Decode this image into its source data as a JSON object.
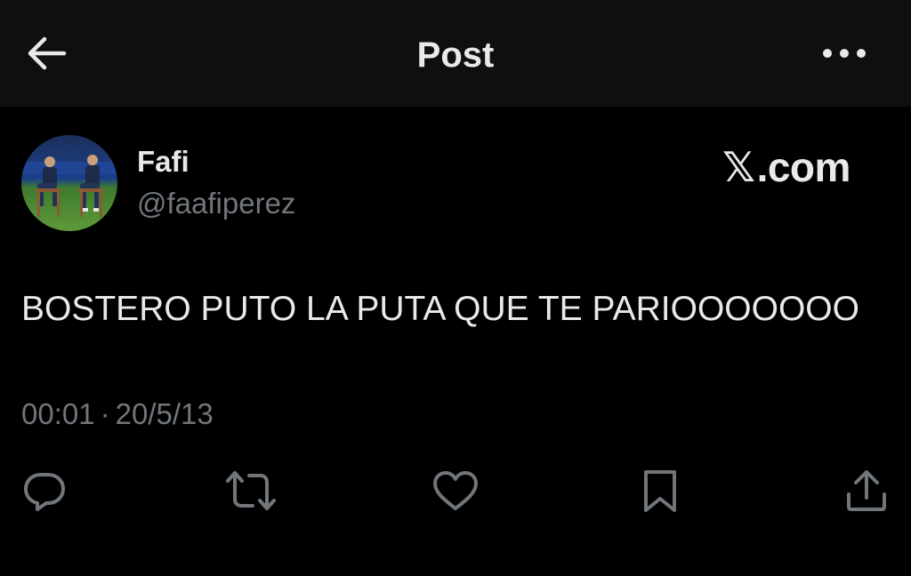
{
  "header": {
    "title": "Post",
    "back_icon": "arrow-left-icon",
    "more_icon": "more-horizontal-icon"
  },
  "post": {
    "author": {
      "display_name": "Fafi",
      "handle": "@faafiperez",
      "avatar": "avatar-photo"
    },
    "brand": {
      "symbol": "𝕏",
      "suffix": ".com"
    },
    "text": "BOSTERO PUTO LA PUTA QUE TE PARIOOOOOOO",
    "time": "00:01",
    "separator": "·",
    "date": "20/5/13"
  },
  "actions": [
    {
      "name": "reply",
      "icon": "reply-icon"
    },
    {
      "name": "repost",
      "icon": "repost-icon"
    },
    {
      "name": "like",
      "icon": "heart-icon"
    },
    {
      "name": "bookmark",
      "icon": "bookmark-icon"
    },
    {
      "name": "share",
      "icon": "share-icon"
    }
  ],
  "colors": {
    "background": "#000000",
    "header_background": "#0f0f0f",
    "text_primary": "#e7e9ea",
    "text_secondary": "#71767b"
  }
}
